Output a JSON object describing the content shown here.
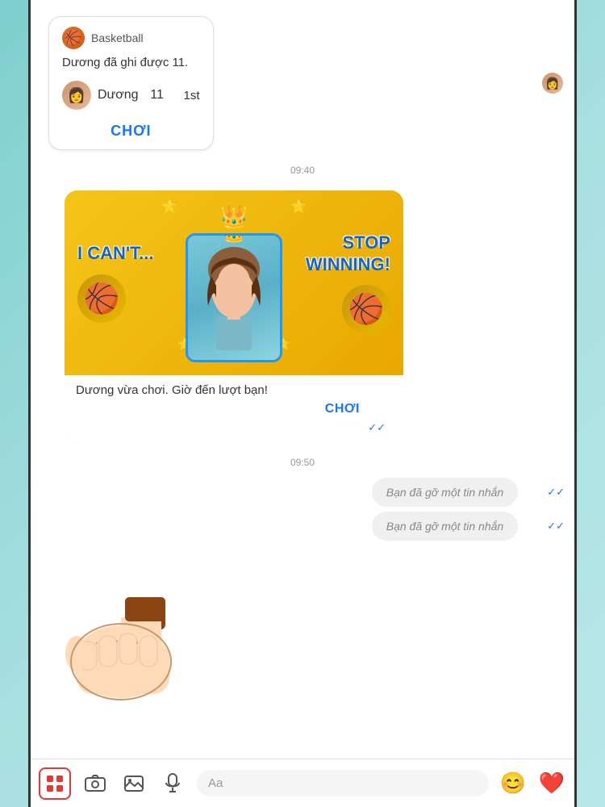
{
  "background": "#a8dde0",
  "chat": {
    "messages": [
      {
        "type": "game_card_incoming",
        "game_title": "Basketball",
        "score_text": "Dương đã ghi được 11.",
        "player": "Dương",
        "score": "11",
        "rank": "1st",
        "play_btn": "CHƠI"
      },
      {
        "type": "timestamp",
        "time": "09:40"
      },
      {
        "type": "winner_card",
        "left_text": "I CAN'T...",
        "right_text": "STOP WINNING!",
        "sub_text": "Dương vừa chơi. Giờ đến lượt bạn!",
        "play_btn": "CHƠI"
      },
      {
        "type": "timestamp",
        "time": "09:50"
      },
      {
        "type": "deleted_msg",
        "text1": "Bạn đã gỡ một tin nhắn",
        "text2": "Bạn đã gỡ một tin nhắn"
      }
    ]
  },
  "toolbar": {
    "apps_label": "apps",
    "camera_label": "camera",
    "image_label": "image",
    "mic_label": "mic",
    "input_placeholder": "Aa",
    "emoji_label": "emoji",
    "heart_label": "heart"
  }
}
